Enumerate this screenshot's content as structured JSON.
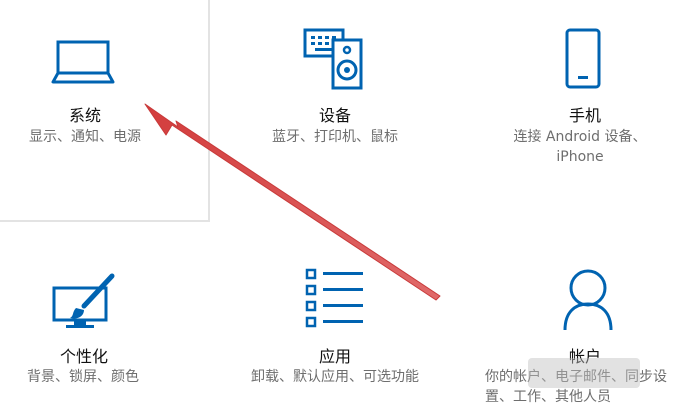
{
  "colors": {
    "icon_blue": "#0063b1",
    "arrow_red": "#d9534f"
  },
  "tiles": [
    {
      "title": "系统",
      "desc": "显示、通知、电源",
      "icon": "laptop-icon"
    },
    {
      "title": "设备",
      "desc": "蓝牙、打印机、鼠标",
      "icon": "keyboard-speaker-icon"
    },
    {
      "title": "手机",
      "desc": "连接 Android 设备、iPhone",
      "icon": "phone-icon"
    },
    {
      "title": "个性化",
      "desc": "背景、锁屏、颜色",
      "icon": "personalization-icon"
    },
    {
      "title": "应用",
      "desc": "卸载、默认应用、可选功能",
      "icon": "apps-list-icon"
    },
    {
      "title": "帐户",
      "desc": "你的帐户、电子邮件、同步设置、工作、其他人员",
      "icon": "account-icon"
    }
  ]
}
